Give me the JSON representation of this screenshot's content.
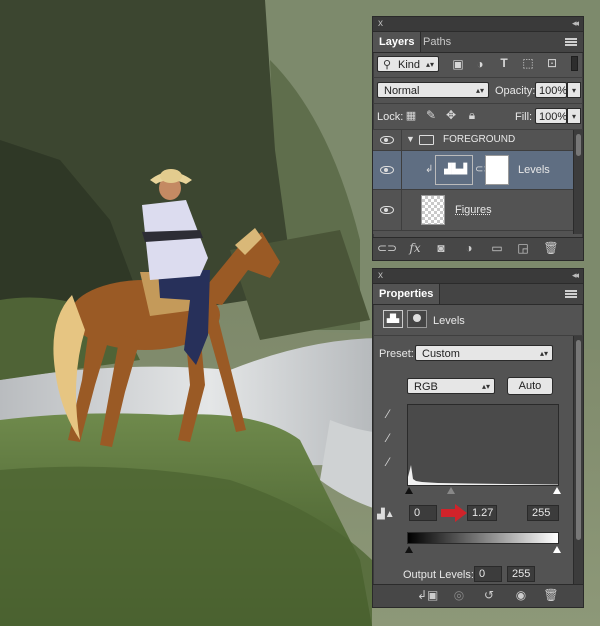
{
  "layers_panel": {
    "close_glyph": "x",
    "collapse_glyph": "◂◂",
    "tabs": [
      {
        "label": "Layers"
      },
      {
        "label": "Paths"
      }
    ],
    "filter": {
      "label": "Kind"
    },
    "blend_mode": "Normal",
    "opacity_label": "Opacity:",
    "opacity_value": "100%",
    "lock_label": "Lock:",
    "fill_label": "Fill:",
    "fill_value": "100%",
    "layers": [
      {
        "name": "FOREGROUND",
        "type": "group"
      },
      {
        "name": "Levels",
        "type": "adjustment"
      },
      {
        "name": "Figures",
        "type": "pixel"
      }
    ]
  },
  "properties_panel": {
    "close_glyph": "x",
    "collapse_glyph": "◂◂",
    "tab_label": "Properties",
    "adjustment_name": "Levels",
    "preset_label": "Preset:",
    "preset_value": "Custom",
    "channel_value": "RGB",
    "auto_label": "Auto",
    "input_black": "0",
    "input_gamma": "1.27",
    "input_white": "255",
    "output_label": "Output Levels:",
    "output_black": "0",
    "output_white": "255"
  },
  "colors": {
    "panel_bg": "#535353",
    "selected_row": "#5f6e82",
    "arrow_red": "#d1232a"
  }
}
